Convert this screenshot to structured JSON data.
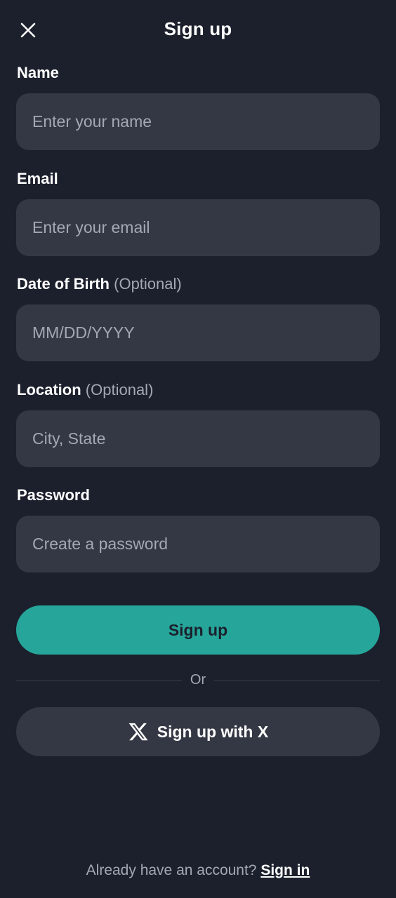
{
  "header": {
    "title": "Sign up",
    "close_icon": "close-icon"
  },
  "form": {
    "name": {
      "label": "Name",
      "placeholder": "Enter your name"
    },
    "email": {
      "label": "Email",
      "placeholder": "Enter your email"
    },
    "dob": {
      "label": "Date of Birth",
      "optional": "(Optional)",
      "placeholder": "MM/DD/YYYY"
    },
    "location": {
      "label": "Location",
      "optional": "(Optional)",
      "placeholder": "City, State"
    },
    "password": {
      "label": "Password",
      "placeholder": "Create a password"
    }
  },
  "actions": {
    "signup_label": "Sign up",
    "divider_text": "Or",
    "signup_x_label": "Sign up with X",
    "x_icon": "x-logo-icon"
  },
  "footer": {
    "prompt": "Already have an account?",
    "signin_label": "Sign in"
  },
  "colors": {
    "background": "#1b202c",
    "input_background": "#343844",
    "accent": "#26a69a",
    "muted_text": "#a3a8b3"
  }
}
